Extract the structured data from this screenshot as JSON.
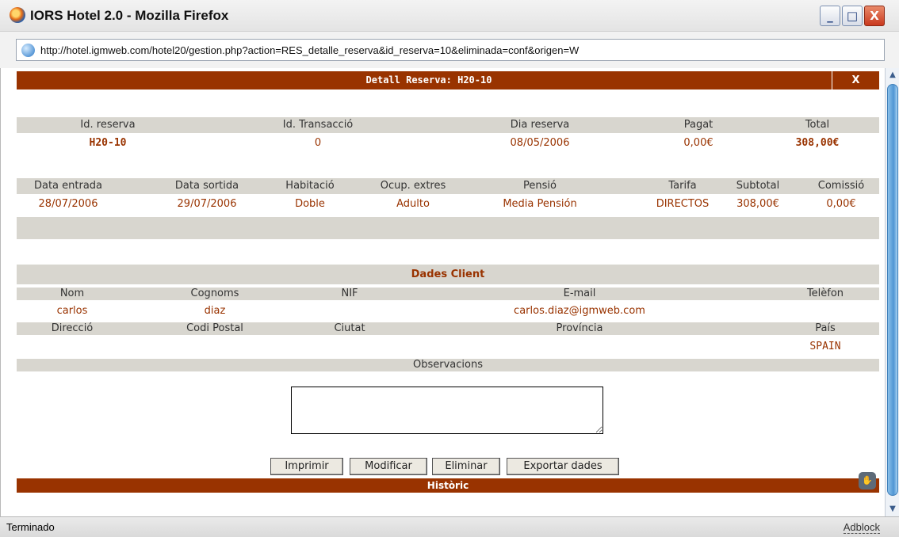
{
  "window": {
    "title": "IORS Hotel 2.0 - Mozilla Firefox",
    "minimize_glyph": "_",
    "maximize_glyph": "□",
    "close_glyph": "X"
  },
  "address": {
    "url": "http://hotel.igmweb.com/hotel20/gestion.php?action=RES_detalle_reserva&id_reserva=10&eliminada=conf&origen=W"
  },
  "header": {
    "title": "Detall Reserva: H20-10",
    "close_label": "X"
  },
  "reserva": {
    "headers": [
      "Id. reserva",
      "Id. Transacció",
      "Dia reserva",
      "Pagat",
      "Total"
    ],
    "values": [
      "H20-10",
      "0",
      "08/05/2006",
      "0,00€",
      "308,00€"
    ]
  },
  "stay": {
    "headers": [
      "Data entrada",
      "Data sortida",
      "Habitació",
      "Ocup. extres",
      "Pensió",
      "Tarifa",
      "Subtotal",
      "Comissió"
    ],
    "values": [
      "28/07/2006",
      "29/07/2006",
      "Doble",
      "Adulto",
      "Media Pensión",
      "DIRECTOS",
      "308,00€",
      "0,00€"
    ]
  },
  "client": {
    "section_title": "Dades Client",
    "headers1": [
      "Nom",
      "Cognoms",
      "NIF",
      "E-mail",
      "Telèfon"
    ],
    "values1": [
      "carlos",
      "diaz",
      "",
      "carlos.diaz@igmweb.com",
      ""
    ],
    "headers2": [
      "Direcció",
      "Codi Postal",
      "Ciutat",
      "Província",
      "País"
    ],
    "values2": [
      "",
      "",
      "",
      "",
      "SPAIN"
    ],
    "observations_label": "Observacions",
    "observations_value": ""
  },
  "actions": {
    "print": "Imprimir",
    "modify": "Modificar",
    "delete": "Eliminar",
    "export": "Exportar dades"
  },
  "history": {
    "title": "Històric"
  },
  "status": {
    "text": "Terminado",
    "adblock": "Adblock"
  },
  "colors": {
    "accent": "#993300",
    "row_grey": "#d8d6cf"
  },
  "icons": {
    "browser": "firefox-logo-icon",
    "page": "globe-icon",
    "grip": "hand-grip-icon"
  }
}
